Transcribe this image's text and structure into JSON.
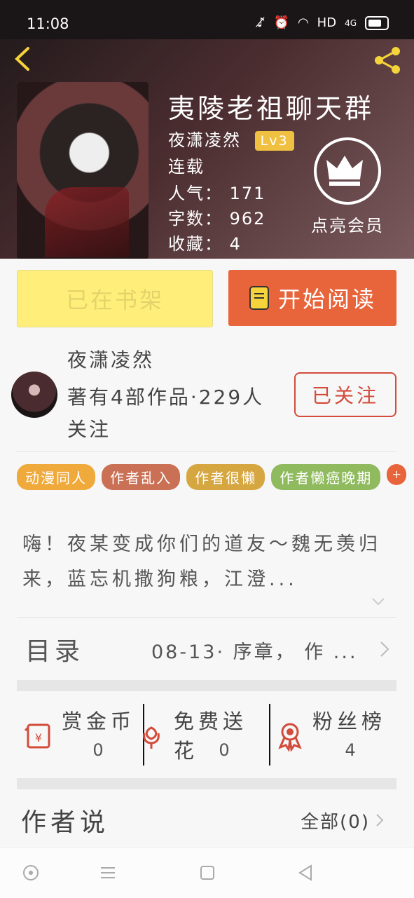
{
  "status": {
    "time": "11:08",
    "network": "HD",
    "signal": "4G"
  },
  "book": {
    "title": "夷陵老祖聊天群",
    "author": "夜潇凌然",
    "level": "Lv3",
    "status": "连载",
    "popularity": "人气： 171",
    "words": "字数： 962",
    "favorites": "收藏： 4",
    "vip_label": "点亮会员"
  },
  "actions": {
    "shelf": "已在书架",
    "read": "开始阅读"
  },
  "author": {
    "name": "夜潇凌然",
    "meta": "著有4部作品·229人关注",
    "follow": "已关注"
  },
  "tags": [
    {
      "label": "动漫同人",
      "color": "#f0a93b"
    },
    {
      "label": "作者乱入",
      "color": "#c97055"
    },
    {
      "label": "作者很懒",
      "color": "#d6a640"
    },
    {
      "label": "作者懒癌晚期",
      "color": "#8fba5e"
    }
  ],
  "tag_more": "+",
  "description": "嗨！夜某变成你们的道友～魏无羡归来，蓝忘机撒狗粮，江澄...",
  "catalog": {
    "label": "目录",
    "latest": "08-13· 序章， 作 ..."
  },
  "stats": [
    {
      "label": "赏金币",
      "value": "0"
    },
    {
      "label": "免费送花",
      "value": "0"
    },
    {
      "label": "粉丝榜",
      "value": "4"
    }
  ],
  "author_say": {
    "label": "作者说",
    "all": "全部(0)"
  }
}
